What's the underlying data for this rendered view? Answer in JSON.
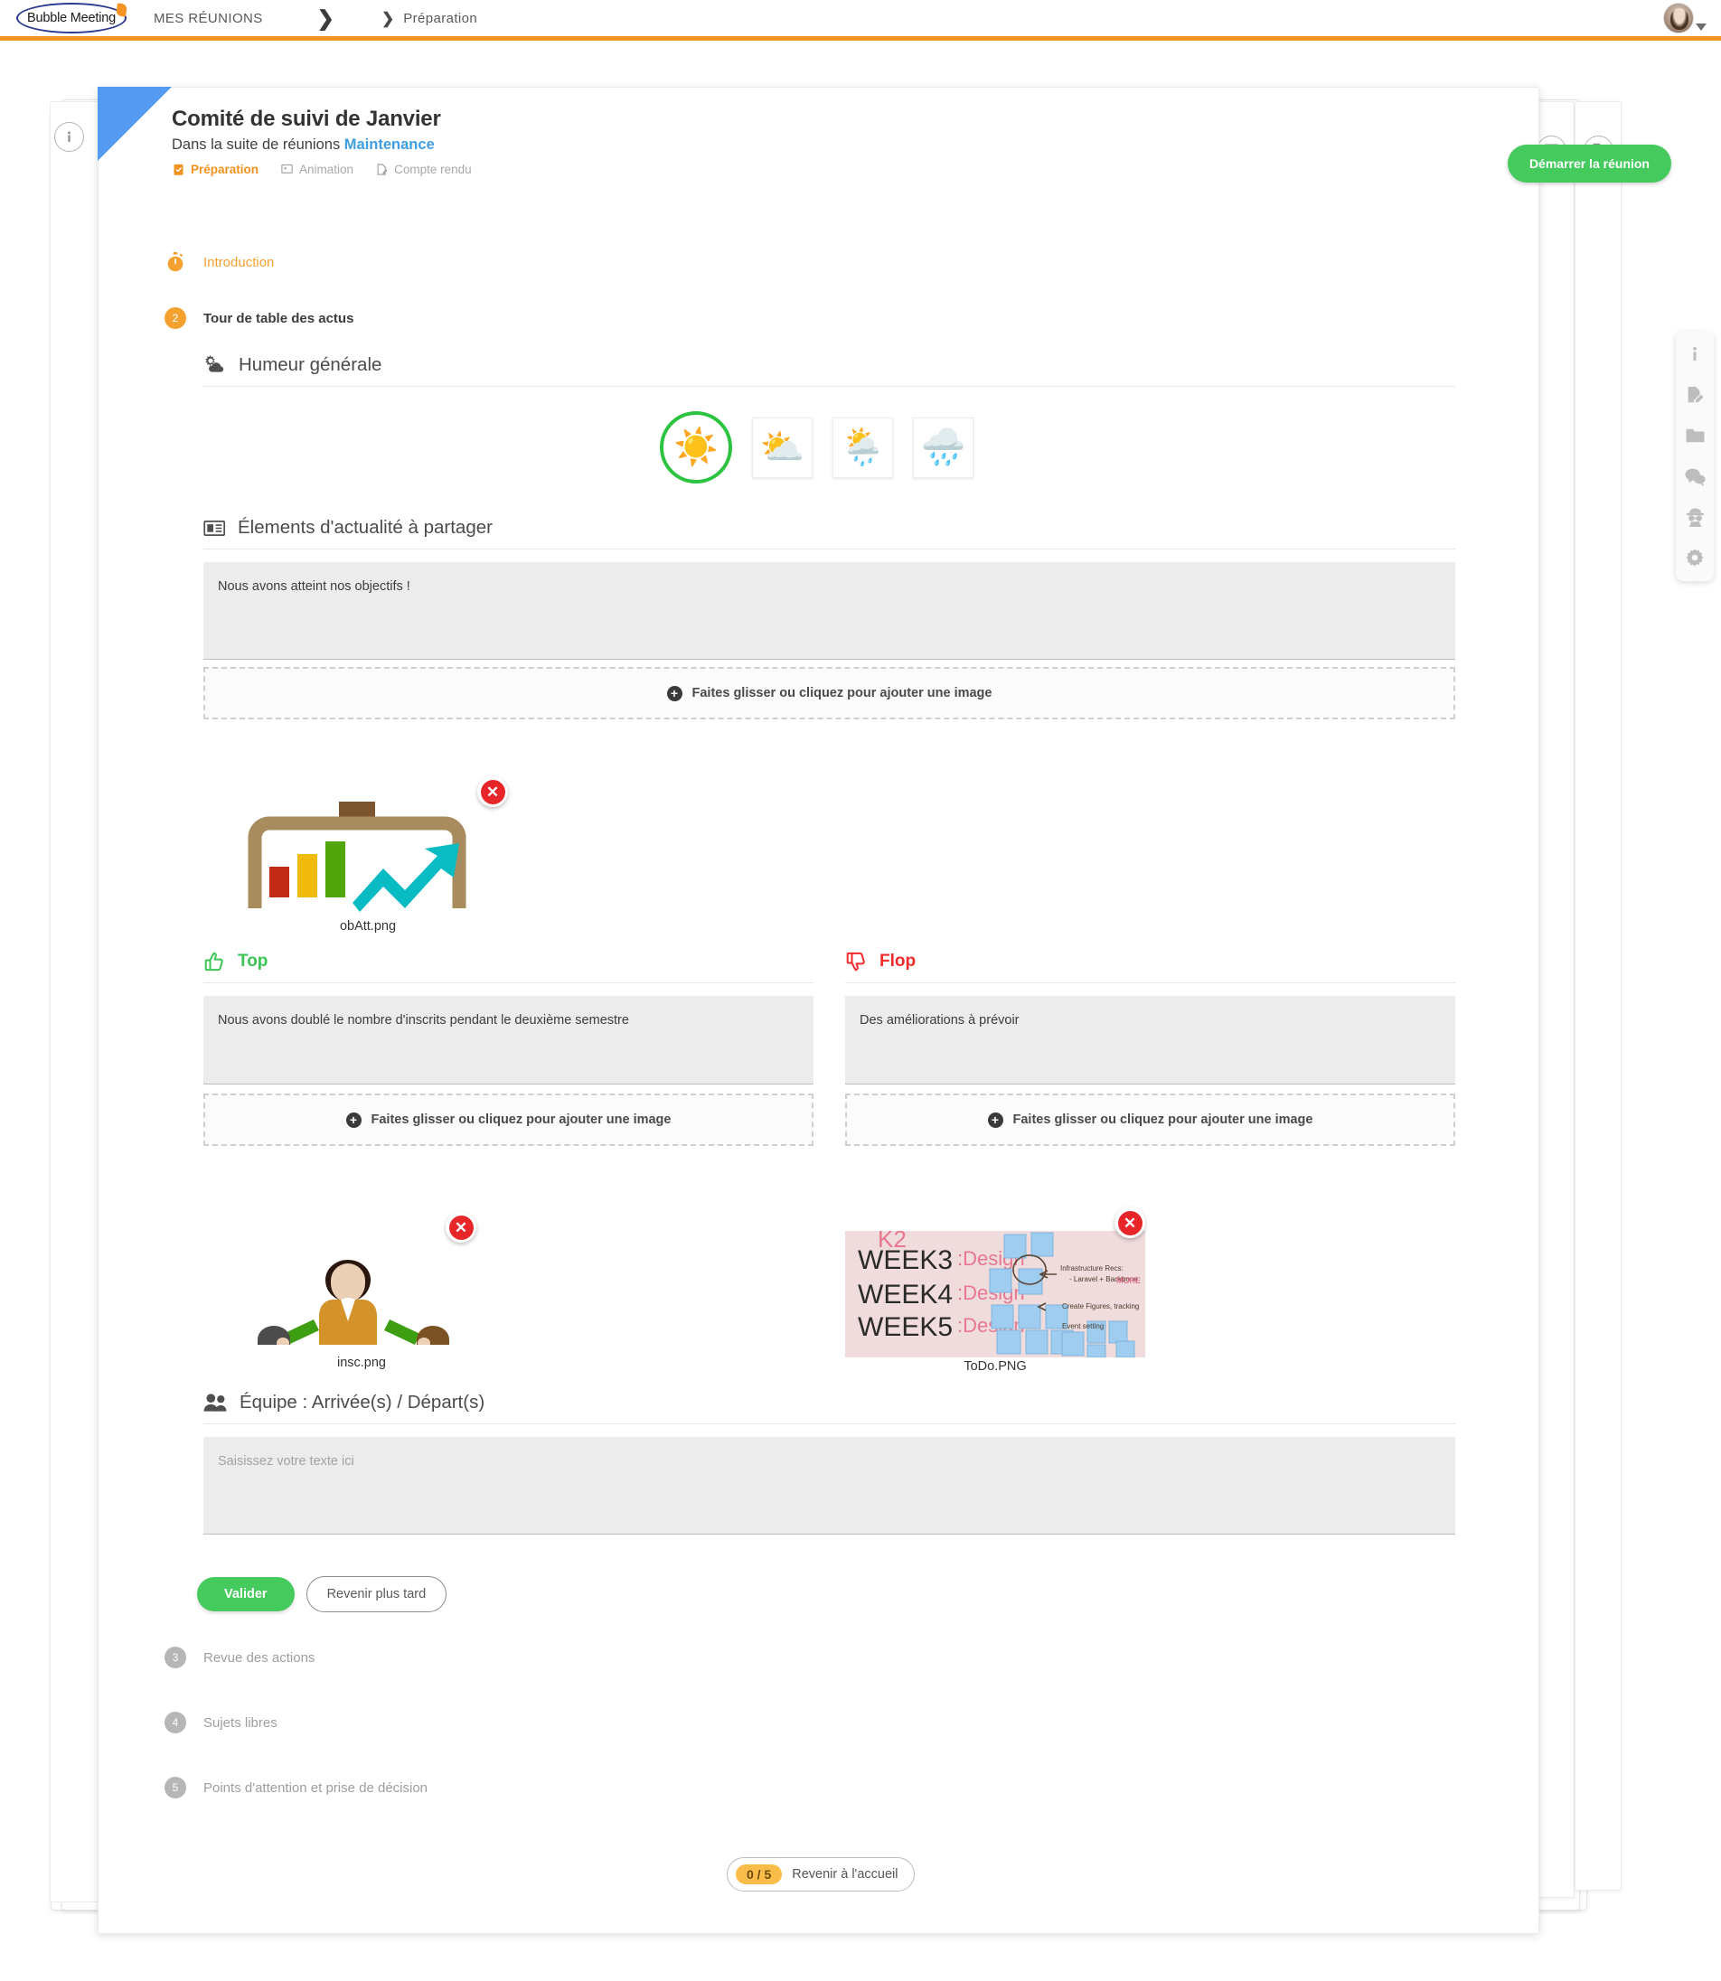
{
  "topbar": {
    "logo_text": "Bubble Meeting",
    "breadcrumb1": "MES RÉUNIONS",
    "breadcrumb2": "Préparation",
    "chevron_big": "❯",
    "chevron_small": "❯",
    "avatar_name": "user-avatar"
  },
  "card": {
    "title": "Comité de suivi de Janvier",
    "subtitle_prefix": "Dans la suite de réunions",
    "series_name": "Maintenance",
    "phases": [
      {
        "label": "Préparation",
        "state": "active",
        "icon": "clipboard-check-icon"
      },
      {
        "label": "Animation",
        "state": "inactive",
        "icon": "presentation-icon"
      },
      {
        "label": "Compte rendu",
        "state": "inactive",
        "icon": "report-pen-icon"
      }
    ],
    "start_button": "Démarrer la réunion",
    "info_icon": "info-icon",
    "side_tab_icons": [
      "presentation-icon",
      "report-pen-icon"
    ]
  },
  "agenda": [
    {
      "num": "1",
      "label": "Introduction",
      "state": "orange",
      "icon": "stopwatch-icon"
    },
    {
      "num": "2",
      "label": "Tour de table des actus",
      "state": "current"
    },
    {
      "num": "3",
      "label": "Revue des actions",
      "state": "grey"
    },
    {
      "num": "4",
      "label": "Sujets libres",
      "state": "grey"
    },
    {
      "num": "5",
      "label": "Points d'attention et prise de décision",
      "state": "grey"
    }
  ],
  "sections": {
    "mood": {
      "title": "Humeur générale",
      "icon": "sun-cloud-icon",
      "options": [
        {
          "name": "sunny",
          "emoji": "☀️",
          "selected": true
        },
        {
          "name": "partly-cloudy",
          "emoji": "⛅",
          "selected": false
        },
        {
          "name": "rain-shower",
          "emoji": "🌦️",
          "selected": false
        },
        {
          "name": "storm-rain",
          "emoji": "🌧️",
          "selected": false
        }
      ],
      "selected_color": "#2cc340"
    },
    "news": {
      "title": "Élements d'actualité à partager",
      "icon": "newspaper-icon",
      "value": "Nous avons atteint nos objectifs !",
      "placeholder": "Saisissez votre texte ici",
      "dropzone_label": "Faites glisser ou cliquez pour ajouter une image",
      "attachment": {
        "filename": "obAtt.png",
        "alt": "tv-chart-arrow-image",
        "delete_label": "✕"
      }
    },
    "top": {
      "title": "Top",
      "icon": "thumbs-up-icon",
      "color": "#3cc457",
      "value": "Nous avons doublé le nombre d'inscrits pendant le deuxième semestre",
      "placeholder": "Saisissez votre texte ici",
      "dropzone_label": "Faites glisser ou cliquez pour ajouter une image",
      "attachment": {
        "filename": "insc.png",
        "alt": "people-group-image",
        "delete_label": "✕"
      }
    },
    "flop": {
      "title": "Flop",
      "icon": "thumbs-down-icon",
      "color": "#f02b2b",
      "value": "Des améliorations à prévoir",
      "placeholder": "Saisissez votre texte ici",
      "dropzone_label": "Faites glisser ou cliquez pour ajouter une image",
      "attachment": {
        "filename": "ToDo.PNG",
        "alt": "whiteboard-sticky-notes-photo",
        "delete_label": "✕"
      }
    },
    "team": {
      "title": "Équipe : Arrivée(s) / Départ(s)",
      "icon": "users-icon",
      "value": "",
      "placeholder": "Saisissez votre texte ici"
    }
  },
  "actions": {
    "validate": "Valider",
    "later": "Revenir plus tard"
  },
  "footer": {
    "count": "0 / 5",
    "label": "Revenir à l'accueil"
  },
  "dock": [
    {
      "name": "info-icon"
    },
    {
      "name": "report-pen-icon"
    },
    {
      "name": "folder-icon"
    },
    {
      "name": "chat-bubbles-icon"
    },
    {
      "name": "spy-icon"
    },
    {
      "name": "gear-icon"
    }
  ],
  "colors": {
    "brand_orange": "#f39423",
    "accent_blue": "#539af0",
    "green": "#45cb5d",
    "red": "#e8262a",
    "grey": "#b6b6b6"
  }
}
